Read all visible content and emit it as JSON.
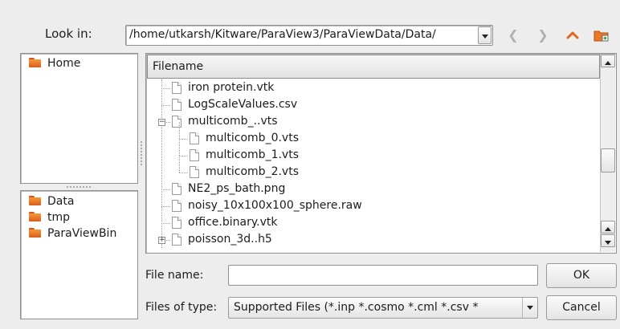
{
  "toolbar": {
    "look_in_label": "Look in:",
    "path": "/home/utkarsh/Kitware/ParaView3/ParaViewData/Data/"
  },
  "places": {
    "top": [
      {
        "label": "Home",
        "icon": "folder-icon"
      }
    ],
    "bottom": [
      {
        "label": "Data",
        "icon": "folder-icon"
      },
      {
        "label": "tmp",
        "icon": "folder-icon"
      },
      {
        "label": "ParaViewBin",
        "icon": "folder-icon"
      }
    ]
  },
  "file_list": {
    "header": "Filename",
    "rows": [
      {
        "name": "iron protein.vtk",
        "depth": 0,
        "icon": "file-icon"
      },
      {
        "name": "LogScaleValues.csv",
        "depth": 0,
        "icon": "file-icon"
      },
      {
        "name": "multicomb_..vts",
        "depth": 0,
        "icon": "file-icon",
        "expander": "collapse"
      },
      {
        "name": "multicomb_0.vts",
        "depth": 1,
        "icon": "file-icon"
      },
      {
        "name": "multicomb_1.vts",
        "depth": 1,
        "icon": "file-icon"
      },
      {
        "name": "multicomb_2.vts",
        "depth": 1,
        "icon": "file-icon"
      },
      {
        "name": "NE2_ps_bath.png",
        "depth": 0,
        "icon": "file-icon"
      },
      {
        "name": "noisy_10x100x100_sphere.raw",
        "depth": 0,
        "icon": "file-icon"
      },
      {
        "name": "office.binary.vtk",
        "depth": 0,
        "icon": "file-icon"
      },
      {
        "name": "poisson_3d..h5",
        "depth": 0,
        "icon": "file-icon",
        "expander": "expand"
      }
    ]
  },
  "form": {
    "file_name_label": "File name:",
    "file_name_value": "",
    "files_of_type_label": "Files of type:",
    "files_of_type_value": "Supported Files (*.inp  *.cosmo  *.cml  *.csv *"
  },
  "buttons": {
    "ok": "OK",
    "cancel": "Cancel"
  },
  "colors": {
    "accent_folder": "#e8772a",
    "nav_up_arrow": "#e2641d"
  },
  "scrollbar": {
    "position": 0.6
  }
}
